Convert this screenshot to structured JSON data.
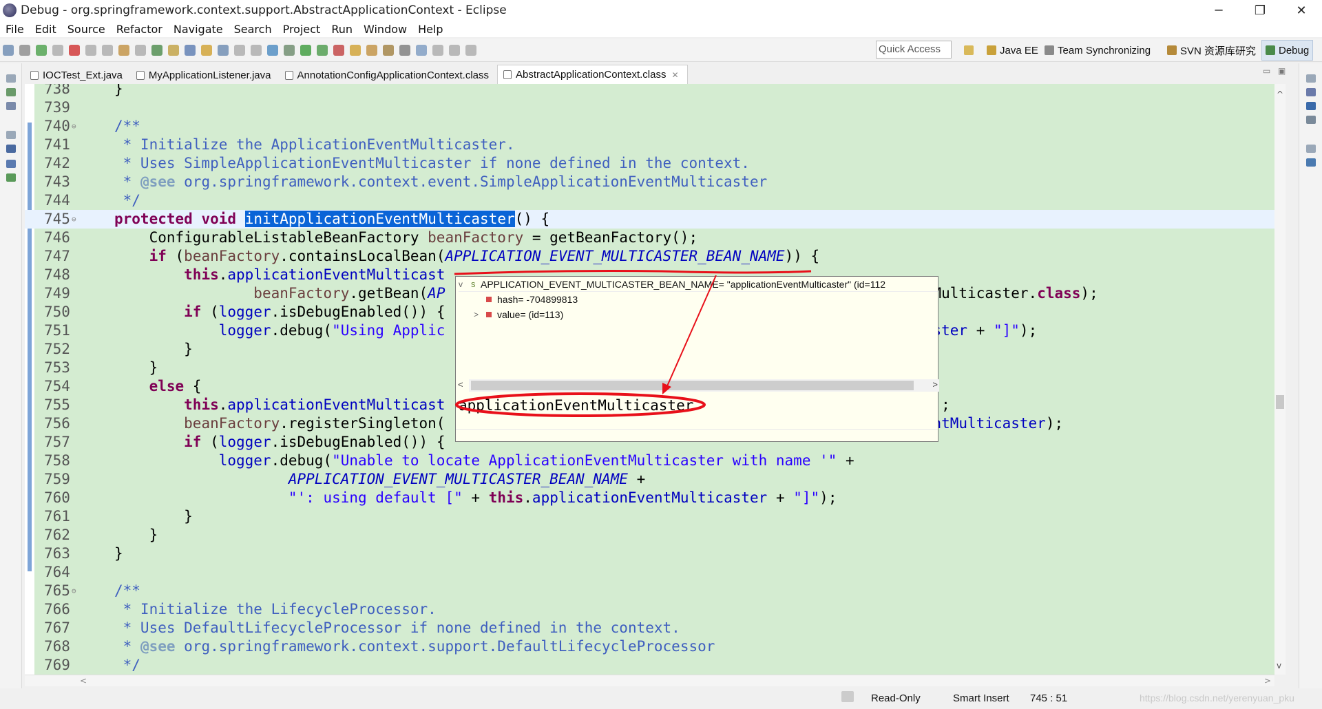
{
  "window": {
    "title": "Debug - org.springframework.context.support.AbstractApplicationContext - Eclipse"
  },
  "menu": [
    "File",
    "Edit",
    "Source",
    "Refactor",
    "Navigate",
    "Search",
    "Project",
    "Run",
    "Window",
    "Help"
  ],
  "quick_access": {
    "placeholder": "Quick Access"
  },
  "perspectives": [
    {
      "label": "Java EE"
    },
    {
      "label": "Team Synchronizing"
    },
    {
      "label": "SVN 资源库研究"
    },
    {
      "label": "Debug"
    }
  ],
  "tabs": [
    {
      "label": "IOCTest_Ext.java"
    },
    {
      "label": "MyApplicationListener.java"
    },
    {
      "label": "AnnotationConfigApplicationContext.class"
    },
    {
      "label": "AbstractApplicationContext.class",
      "close": "✕"
    }
  ],
  "editor": {
    "lines": [
      {
        "n": "738",
        "html": "}",
        "indent": 0
      },
      {
        "n": "739",
        "html": "",
        "indent": 0
      },
      {
        "n": "740",
        "segments": [
          [
            "cm",
            "/**"
          ]
        ],
        "indent": 0,
        "fold": true
      },
      {
        "n": "741",
        "segments": [
          [
            "cm",
            " * Initialize the ApplicationEventMulticaster."
          ]
        ],
        "indent": 0
      },
      {
        "n": "742",
        "segments": [
          [
            "cm",
            " * Uses SimpleApplicationEventMulticaster if none defined in the context."
          ]
        ],
        "indent": 0
      },
      {
        "n": "743",
        "segments": [
          [
            "cm",
            " * "
          ],
          [
            "tag",
            "@see"
          ],
          [
            "cm",
            " org.springframework.context.event.SimpleApplicationEventMulticaster"
          ]
        ],
        "indent": 0
      },
      {
        "n": "744",
        "segments": [
          [
            "cm",
            " */"
          ]
        ],
        "indent": 0
      },
      {
        "n": "745",
        "segments": [
          [
            "kw",
            "protected"
          ],
          [
            "",
            ""
          ],
          [
            "plain",
            " "
          ],
          [
            "kw",
            "void"
          ],
          [
            "plain",
            " "
          ],
          [
            "sel",
            "initApplicationEventMulticaster"
          ],
          [
            "plain",
            "() {"
          ]
        ],
        "indent": 0,
        "fold": true,
        "current": true
      },
      {
        "n": "746",
        "segments": [
          [
            "plain",
            "    ConfigurableListableBeanFactory "
          ],
          [
            "var",
            "beanFactory"
          ],
          [
            "plain",
            " = getBeanFactory();"
          ]
        ]
      },
      {
        "n": "747",
        "segments": [
          [
            "plain",
            "    "
          ],
          [
            "kw",
            "if"
          ],
          [
            "plain",
            " ("
          ],
          [
            "var",
            "beanFactory"
          ],
          [
            "plain",
            ".containsLocalBean("
          ],
          [
            "cst",
            "APPLICATION_EVENT_MULTICASTER_BEAN_NAME"
          ],
          [
            "plain",
            ")) {"
          ]
        ]
      },
      {
        "n": "748",
        "segments": [
          [
            "plain",
            "        "
          ],
          [
            "kw",
            "this"
          ],
          [
            "plain",
            "."
          ],
          [
            "fld",
            "applicationEventMulticast"
          ]
        ]
      },
      {
        "n": "749",
        "segments": [
          [
            "plain",
            "                "
          ],
          [
            "var",
            "beanFactory"
          ],
          [
            "plain",
            ".getBean("
          ],
          [
            "cst",
            "AP"
          ],
          [
            "plain",
            "                                                       tMulticaster."
          ],
          [
            "kw",
            "class"
          ],
          [
            "plain",
            ");"
          ]
        ]
      },
      {
        "n": "750",
        "segments": [
          [
            "plain",
            "        "
          ],
          [
            "kw",
            "if"
          ],
          [
            "plain",
            " ("
          ],
          [
            "fld",
            "logger"
          ],
          [
            "plain",
            ".isDebugEnabled()) {"
          ]
        ]
      },
      {
        "n": "751",
        "segments": [
          [
            "plain",
            "            "
          ],
          [
            "fld",
            "logger"
          ],
          [
            "plain",
            ".debug("
          ],
          [
            "str",
            "\"Using Applic"
          ],
          [
            "plain",
            "                                                       "
          ],
          [
            "fld",
            "aster"
          ],
          [
            "plain",
            " + "
          ],
          [
            "str",
            "\"]\""
          ],
          [
            "plain",
            ");"
          ]
        ]
      },
      {
        "n": "752",
        "segments": [
          [
            "plain",
            "        }"
          ]
        ]
      },
      {
        "n": "753",
        "segments": [
          [
            "plain",
            "    }"
          ]
        ]
      },
      {
        "n": "754",
        "segments": [
          [
            "plain",
            "    "
          ],
          [
            "kw",
            "else"
          ],
          [
            "plain",
            " {"
          ]
        ]
      },
      {
        "n": "755",
        "segments": [
          [
            "plain",
            "        "
          ],
          [
            "kw",
            "this"
          ],
          [
            "plain",
            "."
          ],
          [
            "fld",
            "applicationEventMulticast"
          ],
          [
            "plain",
            "                                                        );"
          ]
        ]
      },
      {
        "n": "756",
        "segments": [
          [
            "plain",
            "        "
          ],
          [
            "var",
            "beanFactory"
          ],
          [
            "plain",
            ".registerSingleton("
          ],
          [
            "plain",
            "                                                  "
          ],
          [
            "fld",
            "ionEventMulticaster"
          ],
          [
            "plain",
            ");"
          ]
        ]
      },
      {
        "n": "757",
        "segments": [
          [
            "plain",
            "        "
          ],
          [
            "kw",
            "if"
          ],
          [
            "plain",
            " ("
          ],
          [
            "fld",
            "logger"
          ],
          [
            "plain",
            ".isDebugEnabled()) {"
          ]
        ]
      },
      {
        "n": "758",
        "segments": [
          [
            "plain",
            "            "
          ],
          [
            "fld",
            "logger"
          ],
          [
            "plain",
            ".debug("
          ],
          [
            "str",
            "\"Unable to locate ApplicationEventMulticaster with name '\""
          ],
          [
            "plain",
            " +"
          ]
        ]
      },
      {
        "n": "759",
        "segments": [
          [
            "plain",
            "                    "
          ],
          [
            "cst",
            "APPLICATION_EVENT_MULTICASTER_BEAN_NAME"
          ],
          [
            "plain",
            " +"
          ]
        ]
      },
      {
        "n": "760",
        "segments": [
          [
            "plain",
            "                    "
          ],
          [
            "str",
            "\"': using default [\""
          ],
          [
            "plain",
            " + "
          ],
          [
            "kw",
            "this"
          ],
          [
            "plain",
            "."
          ],
          [
            "fld",
            "applicationEventMulticaster"
          ],
          [
            "plain",
            " + "
          ],
          [
            "str",
            "\"]\""
          ],
          [
            "plain",
            ");"
          ]
        ]
      },
      {
        "n": "761",
        "segments": [
          [
            "plain",
            "        }"
          ]
        ]
      },
      {
        "n": "762",
        "segments": [
          [
            "plain",
            "    }"
          ]
        ]
      },
      {
        "n": "763",
        "segments": [
          [
            "plain",
            "}"
          ]
        ]
      },
      {
        "n": "764",
        "segments": [
          [
            "plain",
            ""
          ]
        ]
      },
      {
        "n": "765",
        "segments": [
          [
            "cm",
            "/**"
          ]
        ],
        "fold": true
      },
      {
        "n": "766",
        "segments": [
          [
            "cm",
            " * Initialize the LifecycleProcessor."
          ]
        ]
      },
      {
        "n": "767",
        "segments": [
          [
            "cm",
            " * Uses DefaultLifecycleProcessor if none defined in the context."
          ]
        ]
      },
      {
        "n": "768",
        "segments": [
          [
            "cm",
            " * "
          ],
          [
            "tag",
            "@see"
          ],
          [
            "cm",
            " org.springframework.context.support.DefaultLifecycleProcessor"
          ]
        ]
      },
      {
        "n": "769",
        "segments": [
          [
            "cm",
            " */"
          ]
        ]
      }
    ]
  },
  "debug_popup": {
    "root": "APPLICATION_EVENT_MULTICASTER_BEAN_NAME= \"applicationEventMulticaster\" (id=112",
    "children": [
      {
        "label": "hash= -704899813"
      },
      {
        "label": "value= (id=113)"
      }
    ],
    "detail": "applicationEventMulticaster"
  },
  "status": {
    "read_only": "Read-Only",
    "insert_mode": "Smart Insert",
    "position": "745 : 51",
    "watermark": "https://blog.csdn.net/yerenyuan_pku"
  },
  "colors": {
    "editor_bg": "#d4ecd1",
    "selection": "#0a64d7",
    "annotation_red": "#e8101a"
  }
}
